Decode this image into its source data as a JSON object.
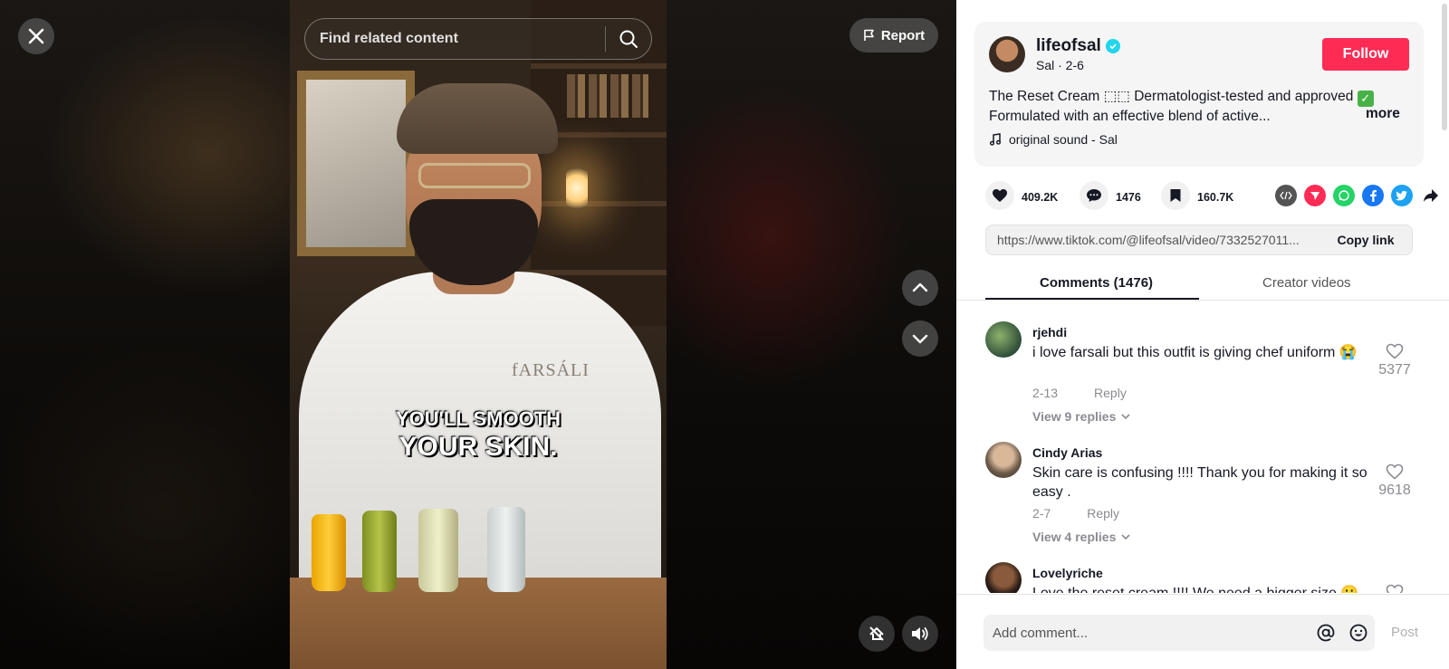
{
  "search": {
    "placeholder": "Find related content"
  },
  "report_label": "Report",
  "video": {
    "caption_line1": "YOU'LL SMOOTH",
    "caption_line2": "YOUR SKIN.",
    "brand_text": "fARSÁLI"
  },
  "author": {
    "username": "lifeofsal",
    "subline": "Sal · 2-6",
    "follow_label": "Follow",
    "description_line1": "The Reset Cream ⬚⬚ Dermatologist-tested and approved",
    "description_line2": "Formulated with an effective blend of active...",
    "more_label": "more",
    "sound": "original sound - Sal"
  },
  "stats": {
    "likes": "409.2K",
    "comments": "1476",
    "saves": "160.7K"
  },
  "share_icons": [
    "embed-icon",
    "send-icon",
    "whatsapp-icon",
    "facebook-icon",
    "twitter-icon",
    "share-arrow-icon"
  ],
  "link": {
    "url": "https://www.tiktok.com/@lifeofsal/video/7332527011...",
    "copy_label": "Copy link"
  },
  "tabs": {
    "comments": "Comments (1476)",
    "creator": "Creator videos"
  },
  "comments": [
    {
      "user": "rjehdi",
      "text": "i love farsali but this outfit is giving chef uniform 😭",
      "date": "2-13",
      "reply": "Reply",
      "replies": "View 9 replies",
      "likes": "5377"
    },
    {
      "user": "Cindy Arias",
      "text": "Skin care is confusing !!!! Thank you for making it so easy .",
      "date": "2-7",
      "reply": "Reply",
      "replies": "View 4 replies",
      "likes": "9618"
    },
    {
      "user": "Lovelyriche",
      "text": "Love the reset cream !!!! We need a bigger size 🥲"
    }
  ],
  "footer": {
    "placeholder": "Add comment...",
    "post_label": "Post"
  },
  "colors": {
    "accent": "#fe2c55",
    "verified": "#20d5ec",
    "text": "#161823",
    "muted": "#8a8b91"
  }
}
